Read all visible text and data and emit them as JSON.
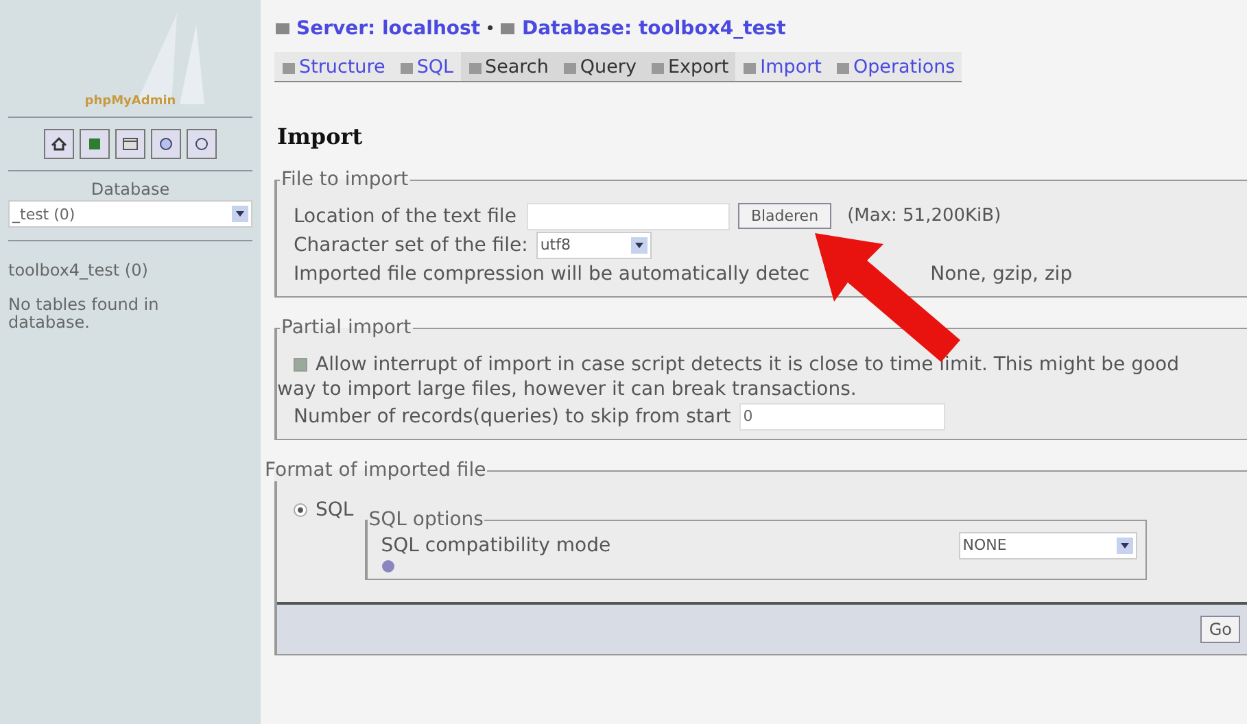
{
  "sidebar": {
    "logo": "phpMyAdmin",
    "database_label": "Database",
    "database_select": "_test (0)",
    "database_link": "toolbox4_test (0)",
    "note": "No tables found in database."
  },
  "breadcrumb": {
    "separator": "•",
    "items": [
      {
        "label": "Server: localhost"
      },
      {
        "label": "Database: toolbox4_test"
      }
    ]
  },
  "tabs": [
    {
      "label": "Structure",
      "active": false
    },
    {
      "label": "SQL",
      "active": false
    },
    {
      "label": "Search",
      "active": true
    },
    {
      "label": "Query",
      "active": true
    },
    {
      "label": "Export",
      "active": true
    },
    {
      "label": "Import",
      "active": false
    },
    {
      "label": "Operations",
      "active": false
    }
  ],
  "heading": "Import",
  "file_to_import": {
    "legend": "File to import",
    "location_label": "Location of the text file",
    "browse_button": "Bladeren",
    "max_note": "(Max: 51,200KiB)",
    "charset_label": "Character set of the file:",
    "charset_value": "utf8",
    "compression_note_start": "Imported file compression will be automatically detec",
    "compression_note_end": "None, gzip, zip"
  },
  "partial_import": {
    "legend": "Partial import",
    "allow_interrupt": {
      "checked": true,
      "label": "Allow interrupt of import in case script detects it is close to time limit. This might be good",
      "label_continued": "way to import large files, however it can break transactions."
    },
    "skip_label": "Number of records(queries) to skip from start",
    "skip_value": "0"
  },
  "format": {
    "legend": "Format of imported file",
    "options": [
      {
        "label": "SQL",
        "selected": true
      }
    ],
    "sql_options": {
      "legend": "SQL options",
      "compat_label": "SQL compatibility mode",
      "compat_value": "NONE"
    },
    "go_button": "Go"
  }
}
